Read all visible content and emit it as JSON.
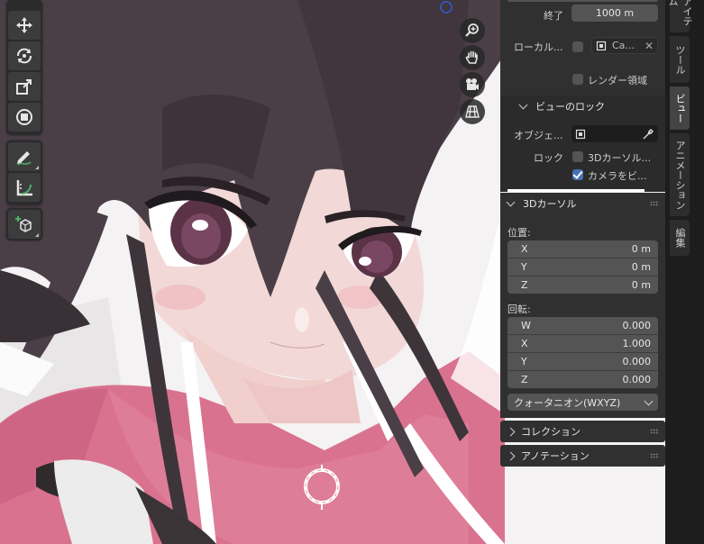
{
  "panel": {
    "clip_end_label": "終了",
    "clip_end_value": "1000 m",
    "local_camera_label": "ローカル...",
    "local_camera_value": "Ca...",
    "render_region_label": "レンダー領域",
    "view_lock_header": "ビューのロック",
    "lock_object_label": "オブジェ...",
    "lock_label": "ロック",
    "lock_3d_cursor_label": "3Dカーソル...",
    "lock_camera_label": "カメラをビ...",
    "cursor_header": "3Dカーソル",
    "location_label": "位置:",
    "location": [
      {
        "axis": "X",
        "value": "0 m"
      },
      {
        "axis": "Y",
        "value": "0 m"
      },
      {
        "axis": "Z",
        "value": "0 m"
      }
    ],
    "rotation_label": "回転:",
    "rotation": [
      {
        "axis": "W",
        "value": "0.000"
      },
      {
        "axis": "X",
        "value": "1.000"
      },
      {
        "axis": "Y",
        "value": "0.000"
      },
      {
        "axis": "Z",
        "value": "0.000"
      }
    ],
    "rotation_mode": "クォータニオン(WXYZ)",
    "collection_header": "コレクション",
    "annotation_header": "アノテーション",
    "render_region_checked": false,
    "lock_3d_cursor_checked": false,
    "lock_camera_checked": true
  },
  "tabs": {
    "item": "アイテム",
    "tool": "ツール",
    "view": "ビュー",
    "animation": "アニメーション",
    "edit": "編集"
  },
  "colors": {
    "panel_bg": "#303030",
    "field_bg": "#545454",
    "accent_blue": "#4772b3",
    "hair": "#4a3f46",
    "skin": "#f2d6d4",
    "jacket": "#d96f8e"
  }
}
